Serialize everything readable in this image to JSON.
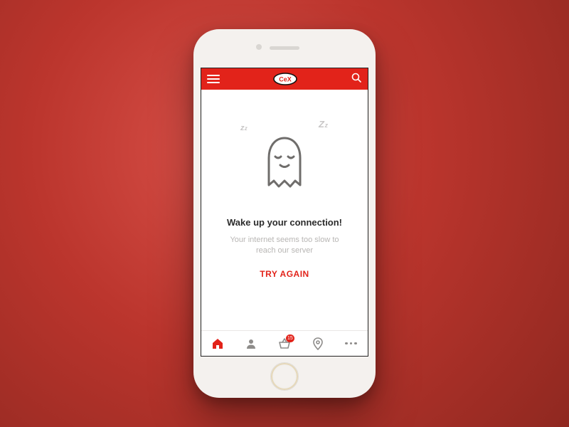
{
  "header": {
    "brand": "CeX",
    "menu_icon": "hamburger",
    "search_icon": "search"
  },
  "error": {
    "ghost_icon": "sleeping-ghost",
    "zzz_left": "z z",
    "zzz_right": "Z z",
    "headline": "Wake up your connection!",
    "subtext": "Your internet seems too slow to reach our server",
    "retry_label": "TRY AGAIN"
  },
  "tabs": {
    "home_icon": "home",
    "profile_icon": "person",
    "basket_icon": "basket",
    "basket_badge": "15",
    "location_icon": "pin",
    "more_icon": "more"
  },
  "colors": {
    "accent": "#e2231a",
    "inactive": "#8e8c8a"
  }
}
